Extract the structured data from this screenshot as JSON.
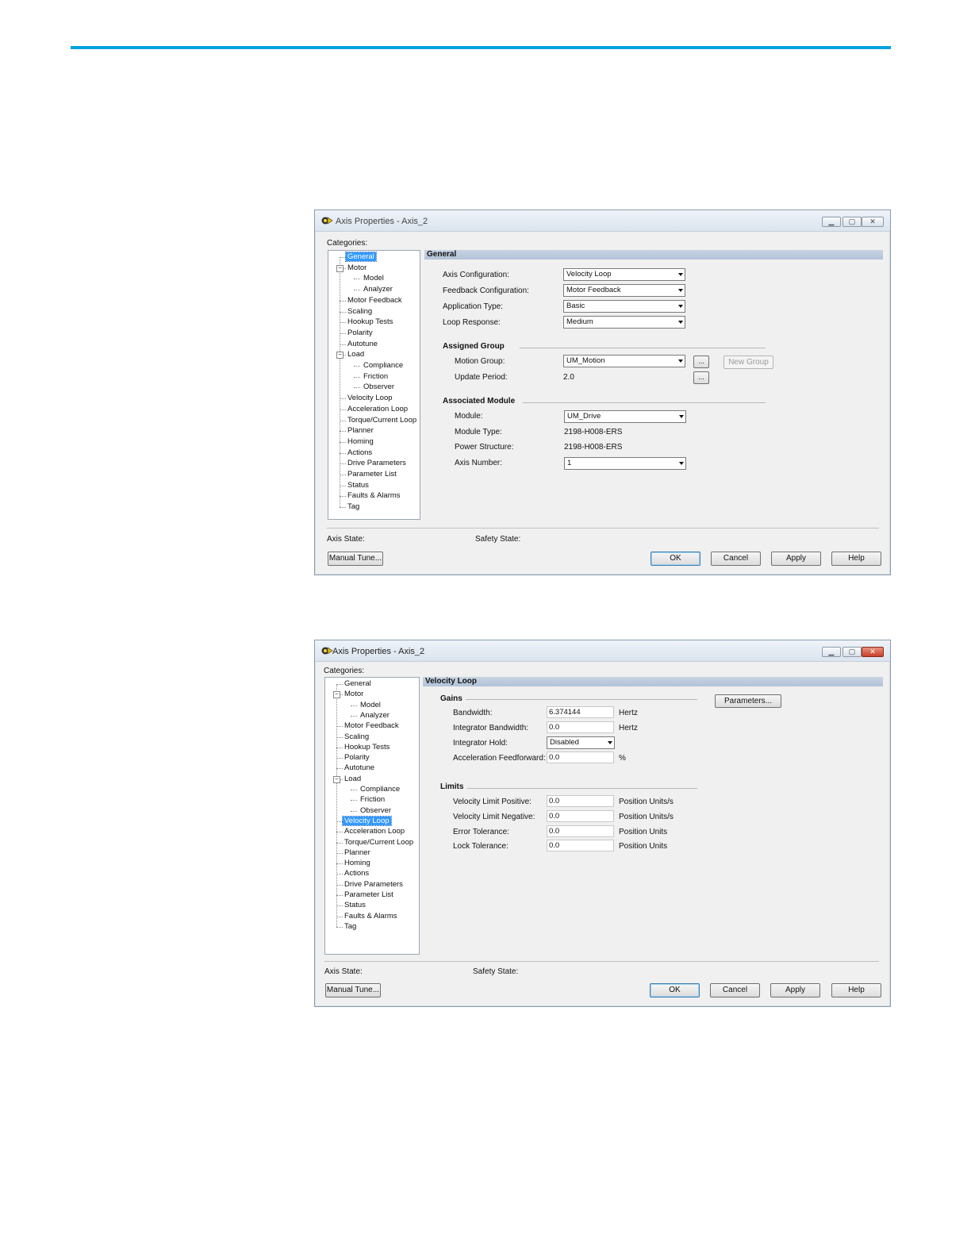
{
  "dialog1": {
    "title": "Axis Properties - Axis_2",
    "categories_label": "Categories:",
    "tree": [
      "General",
      "Motor",
      "Model",
      "Analyzer",
      "Motor Feedback",
      "Scaling",
      "Hookup Tests",
      "Polarity",
      "Autotune",
      "Load",
      "Compliance",
      "Friction",
      "Observer",
      "Velocity Loop",
      "Acceleration Loop",
      "Torque/Current Loop",
      "Planner",
      "Homing",
      "Actions",
      "Drive Parameters",
      "Parameter List",
      "Status",
      "Faults & Alarms",
      "Tag"
    ],
    "selected": "General",
    "section_title": "General",
    "fields": {
      "axis_configuration": {
        "label": "Axis Configuration:",
        "value": "Velocity Loop"
      },
      "feedback_configuration": {
        "label": "Feedback Configuration:",
        "value": "Motor Feedback"
      },
      "application_type": {
        "label": "Application Type:",
        "value": "Basic"
      },
      "loop_response": {
        "label": "Loop Response:",
        "value": "Medium"
      }
    },
    "assigned_group": {
      "title": "Assigned Group",
      "motion_group_label": "Motion Group:",
      "motion_group_value": "UM_Motion",
      "update_period_label": "Update Period:",
      "update_period_value": "2.0",
      "browse_label": "...",
      "new_group_label": "New Group"
    },
    "associated_module": {
      "title": "Associated Module",
      "module_label": "Module:",
      "module_value": "UM_Drive",
      "module_type_label": "Module Type:",
      "module_type_value": "2198-H008-ERS",
      "power_structure_label": "Power Structure:",
      "power_structure_value": "2198-H008-ERS",
      "axis_number_label": "Axis Number:",
      "axis_number_value": "1"
    },
    "axis_state_label": "Axis State:",
    "safety_state_label": "Safety State:",
    "buttons": {
      "manual_tune": "Manual Tune...",
      "ok": "OK",
      "cancel": "Cancel",
      "apply": "Apply",
      "help": "Help"
    }
  },
  "dialog2": {
    "title": "Axis Properties - Axis_2",
    "categories_label": "Categories:",
    "tree": [
      "General",
      "Motor",
      "Model",
      "Analyzer",
      "Motor Feedback",
      "Scaling",
      "Hookup Tests",
      "Polarity",
      "Autotune",
      "Load",
      "Compliance",
      "Friction",
      "Observer",
      "Velocity Loop",
      "Acceleration Loop",
      "Torque/Current Loop",
      "Planner",
      "Homing",
      "Actions",
      "Drive Parameters",
      "Parameter List",
      "Status",
      "Faults & Alarms",
      "Tag"
    ],
    "selected": "Velocity Loop",
    "section_title": "Velocity Loop",
    "parameters_button": "Parameters...",
    "gains": {
      "title": "Gains",
      "bandwidth": {
        "label": "Bandwidth:",
        "value": "6.374144",
        "unit": "Hertz"
      },
      "integrator_bandwidth": {
        "label": "Integrator Bandwidth:",
        "value": "0.0",
        "unit": "Hertz"
      },
      "integrator_hold": {
        "label": "Integrator Hold:",
        "value": "Disabled"
      },
      "acceleration_feedforward": {
        "label": "Acceleration Feedforward:",
        "value": "0.0",
        "unit": "%"
      }
    },
    "limits": {
      "title": "Limits",
      "velocity_limit_positive": {
        "label": "Velocity Limit Positive:",
        "value": "0.0",
        "unit": "Position Units/s"
      },
      "velocity_limit_negative": {
        "label": "Velocity Limit Negative:",
        "value": "0.0",
        "unit": "Position Units/s"
      },
      "error_tolerance": {
        "label": "Error Tolerance:",
        "value": "0.0",
        "unit": "Position Units"
      },
      "lock_tolerance": {
        "label": "Lock Tolerance:",
        "value": "0.0",
        "unit": "Position Units"
      }
    },
    "axis_state_label": "Axis State:",
    "safety_state_label": "Safety State:",
    "buttons": {
      "manual_tune": "Manual Tune...",
      "ok": "OK",
      "cancel": "Cancel",
      "apply": "Apply",
      "help": "Help"
    }
  }
}
